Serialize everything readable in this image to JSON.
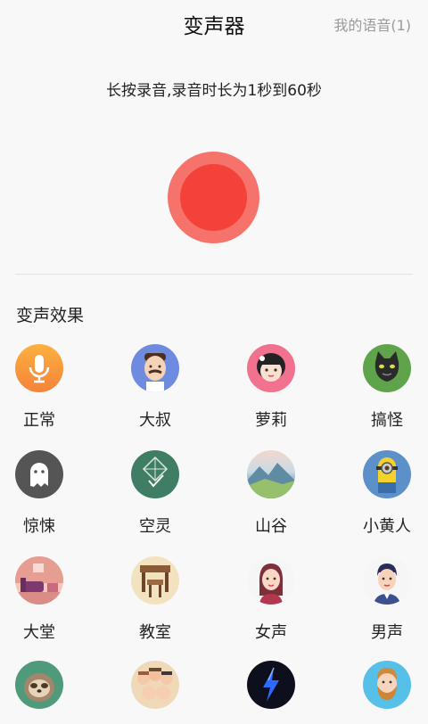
{
  "header": {
    "title": "变声器",
    "my_voice_link": "我的语音(1)"
  },
  "hint": "长按录音,录音时长为1秒到60秒",
  "record_button": {
    "outer_color": "#f5736b",
    "inner_color": "#f4423a"
  },
  "section_title": "变声效果",
  "effects": [
    {
      "label": "正常",
      "icon": "microphone-icon"
    },
    {
      "label": "大叔",
      "icon": "uncle-avatar-icon"
    },
    {
      "label": "萝莉",
      "icon": "girl-avatar-icon"
    },
    {
      "label": "搞怪",
      "icon": "black-cat-icon"
    },
    {
      "label": "惊悚",
      "icon": "ghost-icon"
    },
    {
      "label": "空灵",
      "icon": "kite-icon"
    },
    {
      "label": "山谷",
      "icon": "mountain-valley-icon"
    },
    {
      "label": "小黄人",
      "icon": "minion-icon"
    },
    {
      "label": "大堂",
      "icon": "lobby-sofa-icon"
    },
    {
      "label": "教室",
      "icon": "classroom-desk-icon"
    },
    {
      "label": "女声",
      "icon": "woman-avatar-icon"
    },
    {
      "label": "男声",
      "icon": "man-avatar-icon"
    },
    {
      "label": "",
      "icon": "sloth-icon"
    },
    {
      "label": "",
      "icon": "crowd-icon"
    },
    {
      "label": "",
      "icon": "lightning-icon"
    },
    {
      "label": "",
      "icon": "bearded-man-icon"
    }
  ]
}
